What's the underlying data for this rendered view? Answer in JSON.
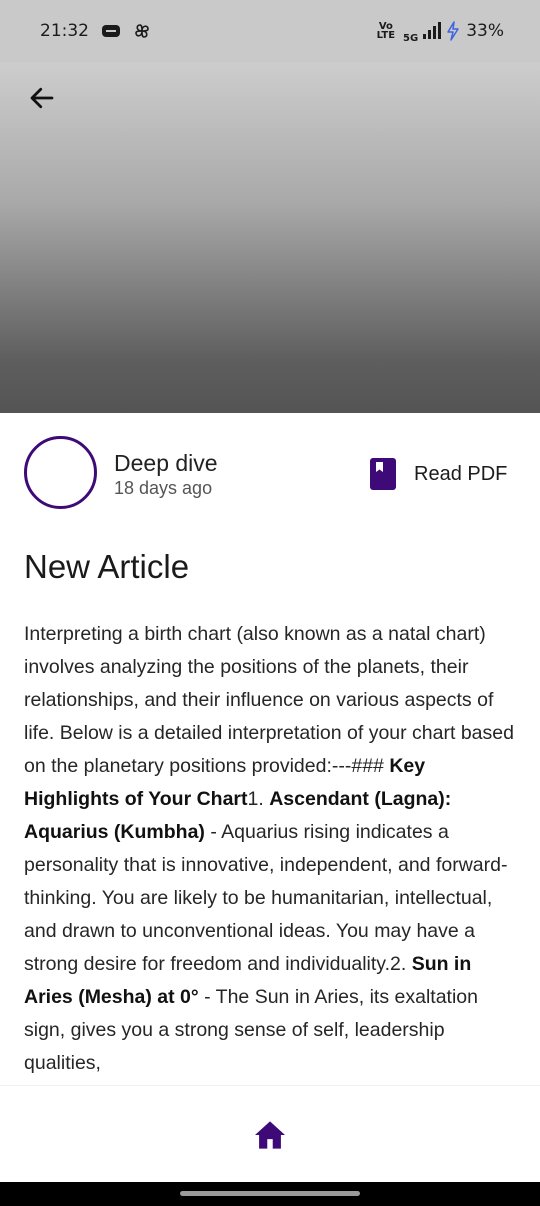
{
  "status_bar": {
    "time": "21:32",
    "volte_top": "Vo",
    "volte_bottom": "LTE",
    "network": "5G",
    "battery": "33%",
    "icons": [
      "media-icon",
      "pinwheel-icon",
      "signal-icon",
      "charging-icon"
    ]
  },
  "author": {
    "name": "Deep dive",
    "time_ago": "18 days ago"
  },
  "actions": {
    "read_pdf": "Read PDF"
  },
  "article": {
    "title": "New Article",
    "body_segments": [
      {
        "text": "Interpreting a birth chart (also known as a natal chart) involves analyzing the positions of the planets, their relationships, and their influence on various aspects of life. Below is a detailed interpretation of your chart based on the planetary positions provided:---### ",
        "bold": false
      },
      {
        "text": "Key Highlights of Your Chart",
        "bold": true
      },
      {
        "text": "1. ",
        "bold": false
      },
      {
        "text": "Ascendant (Lagna): Aquarius (Kumbha)",
        "bold": true
      },
      {
        "text": "    - Aquarius rising indicates a personality that is innovative, independent, and forward-thinking. You are likely to be humanitarian, intellectual, and drawn to unconventional ideas. You may have a strong desire for freedom and individuality.2. ",
        "bold": false
      },
      {
        "text": "Sun in Aries (Mesha) at 0°",
        "bold": true
      },
      {
        "text": "    - The Sun in Aries, its exaltation sign, gives you a strong sense of self, leadership qualities,",
        "bold": false
      }
    ]
  },
  "colors": {
    "accent": "#3d0a78",
    "hero_top": "#cdcdcd",
    "hero_bottom": "#545454",
    "status_bar_bg": "#c9c9c9"
  }
}
